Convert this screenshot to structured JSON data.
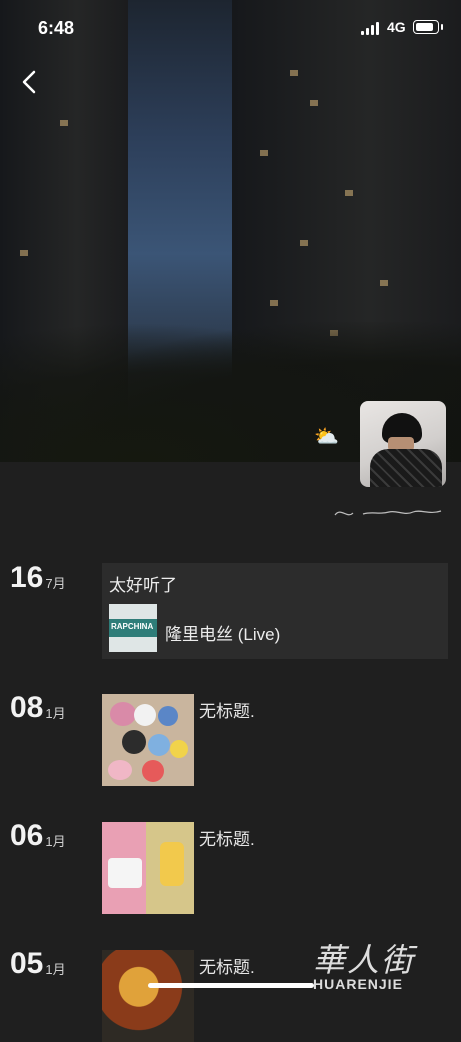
{
  "status_bar": {
    "time": "6:48",
    "network": "4G"
  },
  "posts": [
    {
      "day": "16",
      "month": "7月",
      "text": "太好听了",
      "song": "隆里电丝 (Live)",
      "album_art_text": "RAPCHINA"
    },
    {
      "day": "08",
      "month": "1月",
      "text": "无标题."
    },
    {
      "day": "06",
      "month": "1月",
      "text": "无标题."
    },
    {
      "day": "05",
      "month": "1月",
      "text": "无标题."
    }
  ],
  "watermark": {
    "chinese": "華人街",
    "latin": "HUARENJIE"
  }
}
